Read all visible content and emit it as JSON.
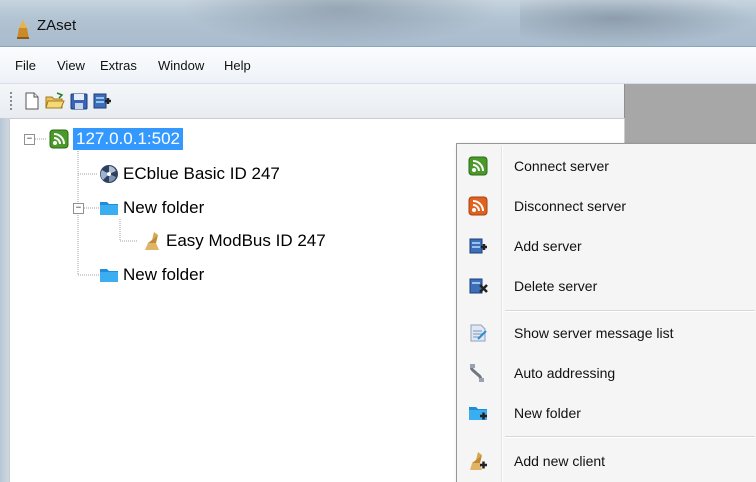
{
  "window": {
    "title": "ZAset"
  },
  "menubar": {
    "items": [
      "File",
      "View",
      "Extras",
      "Window",
      "Help"
    ]
  },
  "toolbar": {
    "buttons": [
      {
        "icon": "new-document-icon"
      },
      {
        "icon": "open-folder-icon"
      },
      {
        "icon": "save-disk-icon"
      },
      {
        "icon": "add-server-icon"
      }
    ]
  },
  "tree": {
    "root": {
      "label": "127.0.0.1:502",
      "icon": "server-connected-icon",
      "expanded": true,
      "selected": true
    },
    "children": [
      {
        "label": "ECblue Basic ID 247",
        "icon": "fan-device-icon"
      },
      {
        "label": "New folder",
        "icon": "folder-icon",
        "expanded": true,
        "children": [
          {
            "label": "Easy ModBus ID 247",
            "icon": "modbus-client-icon"
          }
        ]
      },
      {
        "label": "New folder",
        "icon": "folder-icon"
      }
    ]
  },
  "context_menu": {
    "items": [
      {
        "label": "Connect server",
        "icon": "connect-server-icon"
      },
      {
        "label": "Disconnect server",
        "icon": "disconnect-server-icon"
      },
      {
        "label": "Add server",
        "icon": "add-server-icon"
      },
      {
        "label": "Delete server",
        "icon": "delete-server-icon"
      },
      {
        "label": "Show server message list",
        "icon": "message-list-icon"
      },
      {
        "label": "Auto addressing",
        "icon": "auto-addressing-icon"
      },
      {
        "label": "New folder",
        "icon": "new-folder-icon"
      },
      {
        "label": "Add new client",
        "icon": "add-client-icon"
      }
    ]
  },
  "colors": {
    "selection": "#3399ff",
    "connected_green": "#4a9a2a",
    "disconnected_orange": "#e0621e",
    "folder_blue": "#2a9fe0"
  }
}
